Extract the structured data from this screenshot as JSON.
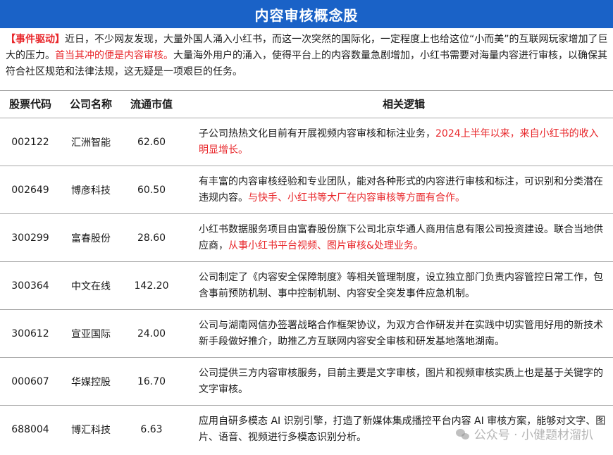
{
  "title": "内容审核概念股",
  "intro": {
    "tag": "【事件驱动】",
    "part1": "近日，不少网友发现，大量外国人涌入小红书，而这一次突然的国际化，一定程度上也给这位“小而美”的互联网玩家增加了巨大的压力。",
    "highlight": "首当其冲的便是内容审核。",
    "part2": "大量海外用户的涌入，使得平台上的内容数量急剧增加，小红书需要对海量内容进行审核，以确保其符合社区规范和法律法规，这无疑是一项艰巨的任务。"
  },
  "table": {
    "headers": [
      "股票代码",
      "公司名称",
      "流通市值",
      "相关逻辑"
    ],
    "rows": [
      {
        "code": "002122",
        "name": "汇洲智能",
        "cap": "62.60",
        "logic": "子公司热热文化目前有开展视频内容审核和标注业务，",
        "logic_red": "2024上半年以来，来自小红书的收入明显增长。"
      },
      {
        "code": "002649",
        "name": "博彦科技",
        "cap": "60.50",
        "logic": "有丰富的内容审核经验和专业团队，能对各种形式的内容进行审核和标注，可识别和分类潜在违规内容。",
        "logic_red": "与快手、小红书等大厂在内容审核等方面有合作。"
      },
      {
        "code": "300299",
        "name": "富春股份",
        "cap": "28.60",
        "logic": "小红书数据服务项目由富春股份旗下公司北京华通人商用信息有限公司投资建设。联合当地供应商，",
        "logic_red": "从事小红书平台视频、图片审核&处理业务。"
      },
      {
        "code": "300364",
        "name": "中文在线",
        "cap": "142.20",
        "logic": "公司制定了《内容安全保障制度》等相关管理制度，设立独立部门负责内容管控日常工作，包含事前预防机制、事中控制机制、内容安全突发事件应急机制。",
        "logic_red": ""
      },
      {
        "code": "300612",
        "name": "宣亚国际",
        "cap": "24.00",
        "logic": "公司与湖南网信办签署战略合作框架协议，为双方合作研发并在实践中切实管用好用的新技术新手段做好推介，助推乙方互联网内容安全审核和研发基地落地湖南。",
        "logic_red": ""
      },
      {
        "code": "000607",
        "name": "华媒控股",
        "cap": "16.70",
        "logic": "公司提供三方内容审核服务，目前主要是文字审核，图片和视频审核实质上也是基于关键字的文字审核。",
        "logic_red": ""
      },
      {
        "code": "688004",
        "name": "博汇科技",
        "cap": "6.63",
        "logic": "应用自研多模态 AI 识别引擎，打造了新媒体集成播控平台内容 AI 审核方案，能够对文字、图片、语音、视频进行多模态识别分析。",
        "logic_red": ""
      }
    ]
  },
  "watermark": "公众号 · 小健题材溜扒",
  "colors": {
    "title_bg": "#1a62c7",
    "highlight": "#e8262a",
    "border": "#a9a9a9"
  }
}
